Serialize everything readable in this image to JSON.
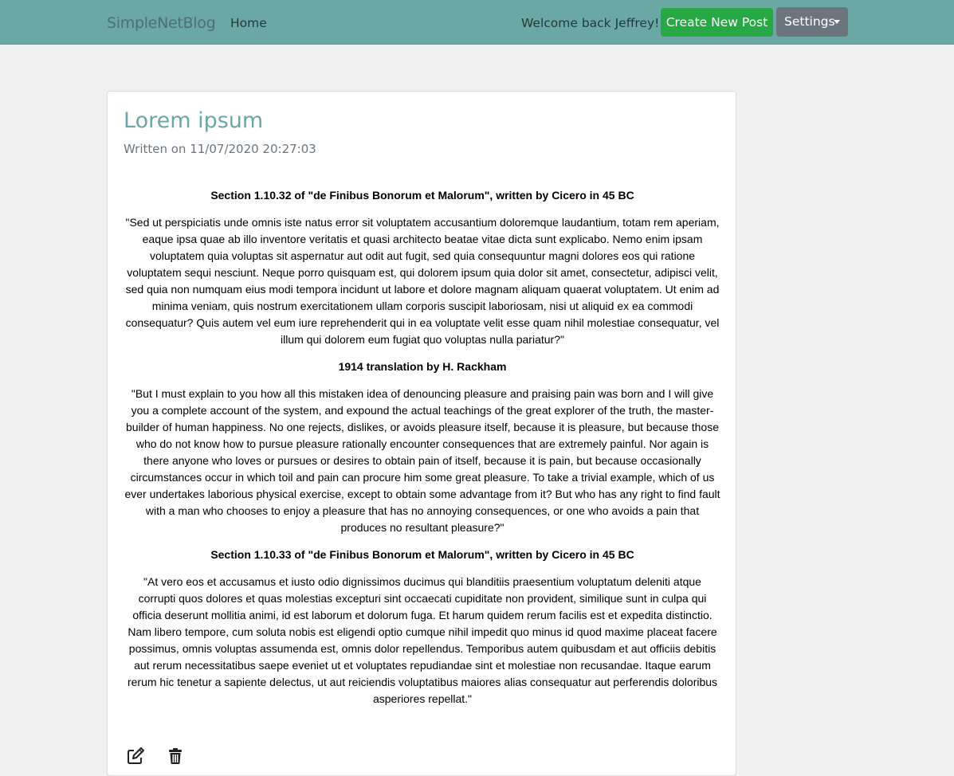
{
  "navbar": {
    "brand": "SimpleNetBlog",
    "home_label": "Home",
    "welcome_text": "Welcome back Jeffrey!",
    "create_label": "Create New Post",
    "settings_label": "Settings",
    "colors": {
      "navbar_bg": "#6aa8a6",
      "create_bg": "#28a745",
      "settings_bg": "#6c757d"
    }
  },
  "post": {
    "title": "Lorem ipsum",
    "date": "Written on 11/07/2020 20:27:03",
    "title_color": "#6aa8a6",
    "sections": [
      {
        "heading": "Section 1.10.32 of \"de Finibus Bonorum et Malorum\", written by Cicero in 45 BC",
        "text": "\"Sed ut perspiciatis unde omnis iste natus error sit voluptatem accusantium doloremque laudantium, totam rem aperiam, eaque ipsa quae ab illo inventore veritatis et quasi architecto beatae vitae dicta sunt explicabo. Nemo enim ipsam voluptatem quia voluptas sit aspernatur aut odit aut fugit, sed quia consequuntur magni dolores eos qui ratione voluptatem sequi nesciunt. Neque porro quisquam est, qui dolorem ipsum quia dolor sit amet, consectetur, adipisci velit, sed quia non numquam eius modi tempora incidunt ut labore et dolore magnam aliquam quaerat voluptatem. Ut enim ad minima veniam, quis nostrum exercitationem ullam corporis suscipit laboriosam, nisi ut aliquid ex ea commodi consequatur? Quis autem vel eum iure reprehenderit qui in ea voluptate velit esse quam nihil molestiae consequatur, vel illum qui dolorem eum fugiat quo voluptas nulla pariatur?\""
      },
      {
        "heading": "1914 translation by H. Rackham",
        "text": "\"But I must explain to you how all this mistaken idea of denouncing pleasure and praising pain was born and I will give you a complete account of the system, and expound the actual teachings of the great explorer of the truth, the master-builder of human happiness. No one rejects, dislikes, or avoids pleasure itself, because it is pleasure, but because those who do not know how to pursue pleasure rationally encounter consequences that are extremely painful. Nor again is there anyone who loves or pursues or desires to obtain pain of itself, because it is pain, but because occasionally circumstances occur in which toil and pain can procure him some great pleasure. To take a trivial example, which of us ever undertakes laborious physical exercise, except to obtain some advantage from it? But who has any right to find fault with a man who chooses to enjoy a pleasure that has no annoying consequences, or one who avoids a pain that produces no resultant pleasure?\""
      },
      {
        "heading": "Section 1.10.33 of \"de Finibus Bonorum et Malorum\", written by Cicero in 45 BC",
        "text": "\"At vero eos et accusamus et iusto odio dignissimos ducimus qui blanditiis praesentium voluptatum deleniti atque corrupti quos dolores et quas molestias excepturi sint occaecati cupiditate non provident, similique sunt in culpa qui officia deserunt mollitia animi, id est laborum et dolorum fuga. Et harum quidem rerum facilis est et expedita distinctio. Nam libero tempore, cum soluta nobis est eligendi optio cumque nihil impedit quo minus id quod maxime placeat facere possimus, omnis voluptas assumenda est, omnis dolor repellendus. Temporibus autem quibusdam et aut officiis debitis aut rerum necessitatibus saepe eveniet ut et voluptates repudiandae sint et molestiae non recusandae. Itaque earum rerum hic tenetur a sapiente delectus, ut aut reiciendis voluptatibus maiores alias consequatur aut perferendis doloribus asperiores repellat.\""
      }
    ],
    "actions": [
      {
        "icon": "edit-icon"
      },
      {
        "icon": "trash-icon"
      }
    ]
  }
}
